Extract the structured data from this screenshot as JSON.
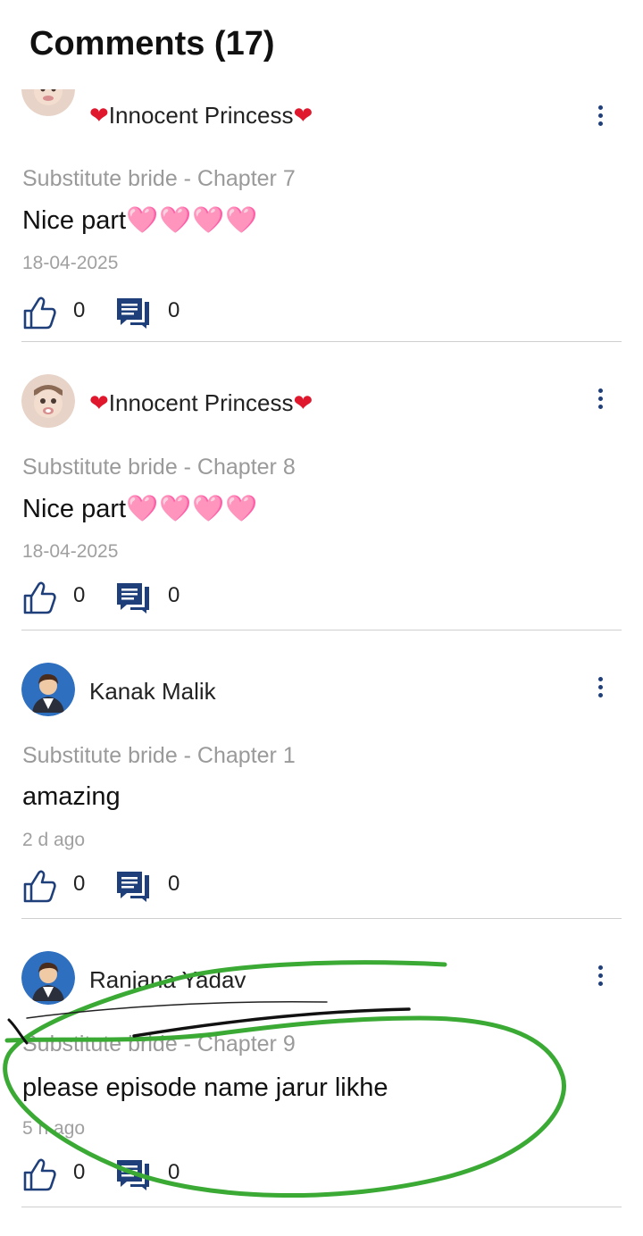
{
  "header": {
    "title": "Comments (17)"
  },
  "comments": [
    {
      "user": "Innocent Princess",
      "user_prefix": "❤",
      "user_suffix": "❤",
      "chapter": "Substitute bride - Chapter 7",
      "text": "Nice part",
      "text_emoji": "🩷🩷🩷🩷",
      "date": "18-04-2025",
      "likes": "0",
      "replies": "0",
      "avatar": "baby-photo"
    },
    {
      "user": "Innocent Princess",
      "user_prefix": "❤",
      "user_suffix": "❤",
      "chapter": "Substitute bride - Chapter 8",
      "text": "Nice part",
      "text_emoji": "🩷🩷🩷🩷",
      "date": "18-04-2025",
      "likes": "0",
      "replies": "0",
      "avatar": "baby-photo"
    },
    {
      "user": "Kanak Malik",
      "user_prefix": "",
      "user_suffix": "",
      "chapter": "Substitute bride - Chapter 1",
      "text": "amazing",
      "text_emoji": "",
      "date": "2 d ago",
      "likes": "0",
      "replies": "0",
      "avatar": "default-male-avatar"
    },
    {
      "user": "Ranjana Yadav",
      "user_prefix": "",
      "user_suffix": "",
      "chapter": "Substitute bride - Chapter 9",
      "text": "please episode name jarur likhe",
      "text_emoji": "",
      "date": "5 h ago",
      "likes": "0",
      "replies": "0",
      "avatar": "default-male-avatar"
    }
  ],
  "colors": {
    "accent": "#1f3f7a",
    "heart": "#e0182d",
    "muted": "#9a9a9a",
    "annotation": "#3aaa35"
  }
}
